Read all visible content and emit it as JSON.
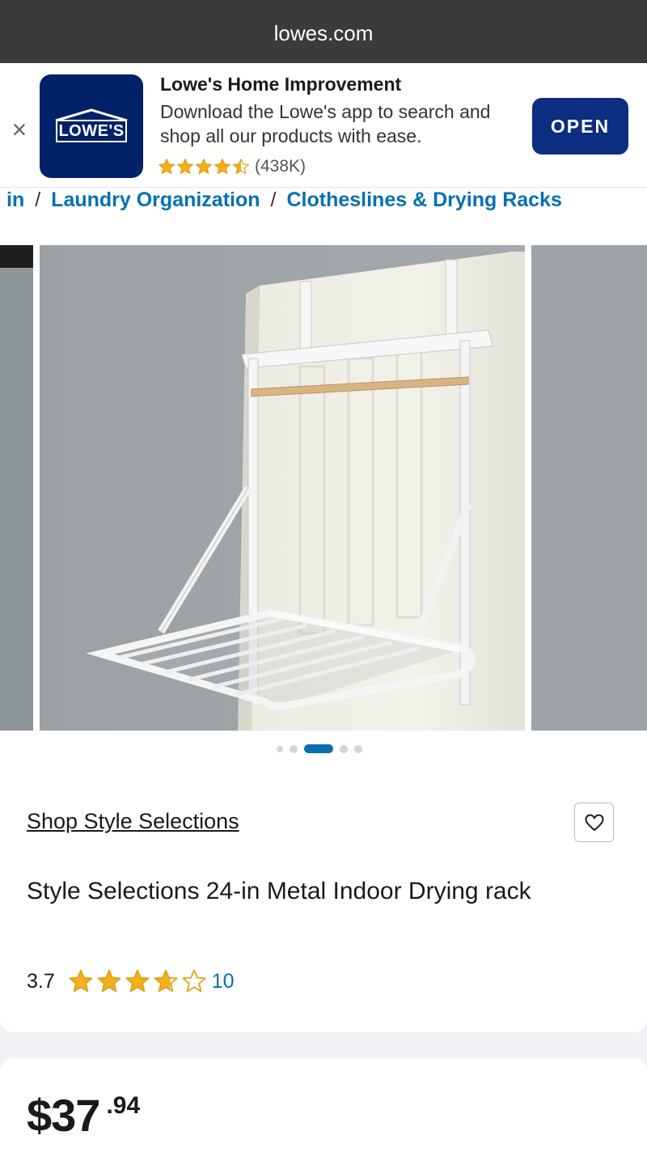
{
  "browser": {
    "url": "lowes.com"
  },
  "app_banner": {
    "close_glyph": "×",
    "logo_text": "LOWE'S",
    "title": "Lowe's Home Improvement",
    "description": "Download the Lowe's app to search and shop all our products with ease.",
    "rating": 4.5,
    "rating_count": "(438K)",
    "open_label": "OPEN",
    "brand_color": "#012169",
    "button_color": "#0b2e80"
  },
  "breadcrumb": {
    "partial_item": "in",
    "separator": "/",
    "items": [
      "Laundry Organization",
      "Clotheslines & Drying Racks"
    ],
    "link_color": "#0471af"
  },
  "gallery": {
    "image_count": 5,
    "active_index": 2,
    "image_subject": "drying-rack-photo",
    "accent_color": "#0471af"
  },
  "product": {
    "brand_link": "Shop Style Selections",
    "title": "Style Selections 24-in Metal Indoor Drying rack",
    "rating_value": "3.7",
    "rating": 3.7,
    "review_count": "10",
    "favorite_icon": "heart-icon",
    "star_color": "#f2b01e"
  },
  "price": {
    "dollars": "$37",
    "cents": ".94"
  }
}
